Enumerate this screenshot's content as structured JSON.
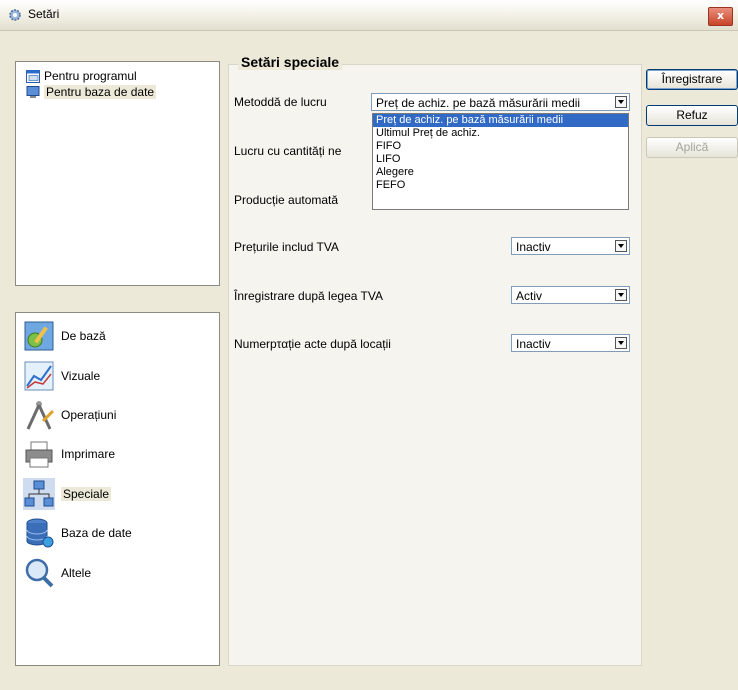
{
  "window": {
    "title": "Setări",
    "close_label": "x"
  },
  "tree": {
    "items": [
      {
        "label": "Pentru programul",
        "icon": "window-icon"
      },
      {
        "label": "Pentru baza de date",
        "icon": "computer-icon"
      }
    ]
  },
  "categories": [
    {
      "label": "De bază",
      "icon": "settings-tools-icon"
    },
    {
      "label": "Vizuale",
      "icon": "chart-icon"
    },
    {
      "label": "Operațiuni",
      "icon": "compass-icon"
    },
    {
      "label": "Imprimare",
      "icon": "printer-icon"
    },
    {
      "label": "Speciale",
      "icon": "network-icon"
    },
    {
      "label": "Baza de date",
      "icon": "database-icon"
    },
    {
      "label": "Altele",
      "icon": "magnifier-icon"
    }
  ],
  "section": {
    "title": "Setări speciale"
  },
  "settings": {
    "method": {
      "label": "Metoddă de lucru",
      "value": "Preț de achiz. pe bază măsurării medii",
      "options": [
        "Preț de achiz. pe bază măsurării medii",
        "Ultimul Preț de achiz.",
        "FIFO",
        "LIFO",
        "Alegere",
        "FEFO"
      ]
    },
    "negative_qty": {
      "label": "Lucru cu cantități ne"
    },
    "auto_production": {
      "label": "Producție automată"
    },
    "prices_vat": {
      "label": "Prețurile includ TVA",
      "value": "Inactiv"
    },
    "vat_registration": {
      "label": "Înregistrare după legea TVA",
      "value": "Activ"
    },
    "numbering": {
      "label": "Numerpταție acte după locații",
      "value": "Inactiv"
    }
  },
  "buttons": {
    "save": "Înregistrare",
    "cancel": "Refuz",
    "apply": "Aplică"
  }
}
